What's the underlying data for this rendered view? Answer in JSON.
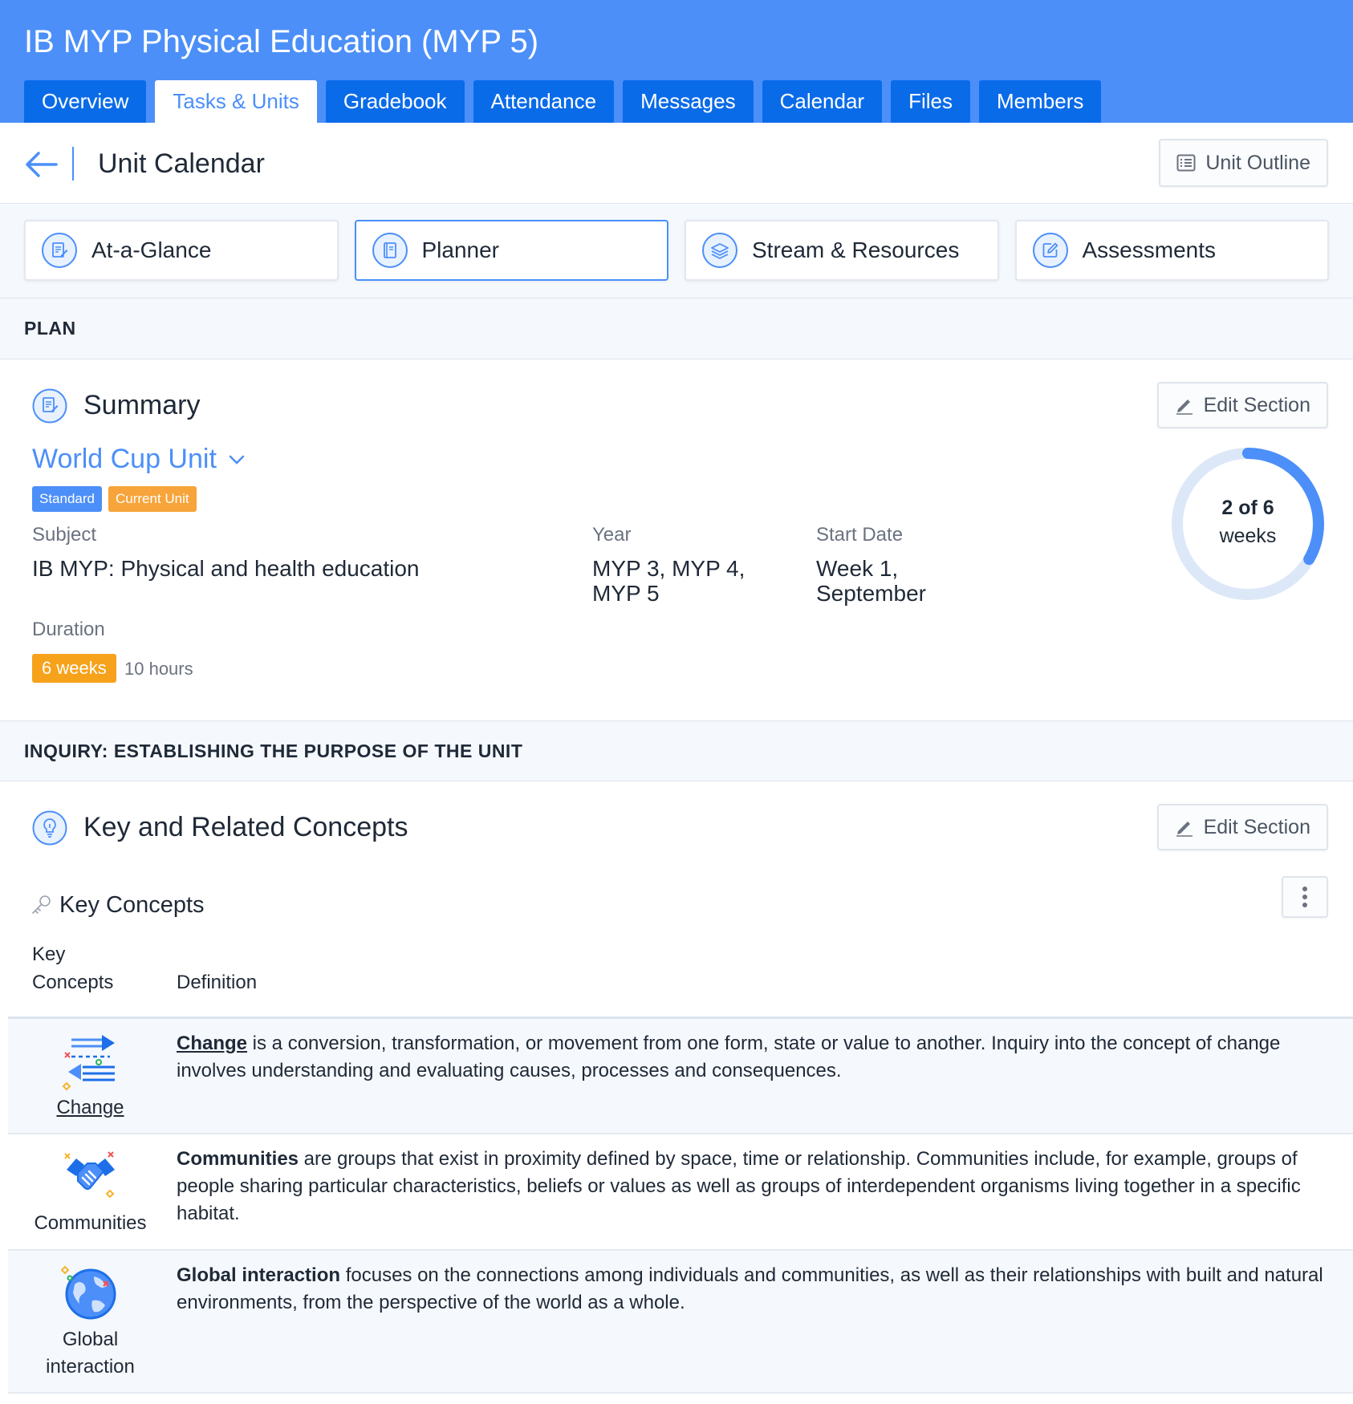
{
  "header": {
    "course_title": "IB MYP Physical Education (MYP 5)",
    "tabs": [
      {
        "label": "Overview"
      },
      {
        "label": "Tasks & Units",
        "active": true
      },
      {
        "label": "Gradebook"
      },
      {
        "label": "Attendance"
      },
      {
        "label": "Messages"
      },
      {
        "label": "Calendar"
      },
      {
        "label": "Files"
      },
      {
        "label": "Members"
      }
    ]
  },
  "subheader": {
    "title": "Unit Calendar",
    "unit_outline_label": "Unit Outline"
  },
  "subtabs": [
    {
      "label": "At-a-Glance",
      "icon": "document-edit-icon"
    },
    {
      "label": "Planner",
      "icon": "book-icon",
      "active": true
    },
    {
      "label": "Stream & Resources",
      "icon": "layers-icon"
    },
    {
      "label": "Assessments",
      "icon": "edit-square-icon"
    }
  ],
  "plan": {
    "heading": "PLAN",
    "summary": {
      "title": "Summary",
      "edit_label": "Edit Section",
      "unit_name": "World Cup Unit",
      "badges": {
        "standard": "Standard",
        "current": "Current Unit"
      },
      "subject_label": "Subject",
      "subject_value": "IB MYP: Physical and health education",
      "year_label": "Year",
      "year_value_line1": "MYP 3, MYP 4,",
      "year_value_line2": "MYP 5",
      "start_label": "Start Date",
      "start_value_line1": "Week 1,",
      "start_value_line2": "September",
      "duration_label": "Duration",
      "duration_weeks": "6 weeks",
      "duration_hours": "10 hours",
      "progress_num": "2 of 6",
      "progress_unit": "weeks",
      "progress_current": 2,
      "progress_total": 6
    }
  },
  "inquiry": {
    "heading": "INQUIRY: ESTABLISHING THE PURPOSE OF THE UNIT",
    "concepts": {
      "title": "Key and Related Concepts",
      "edit_label": "Edit Section",
      "subtitle": "Key Concepts",
      "col_key_line1": "Key",
      "col_key_line2": "Concepts",
      "col_definition": "Definition",
      "rows": [
        {
          "name": "Change",
          "term": "Change",
          "definition": " is a conversion, transformation, or movement from one form, state or value to another. Inquiry into the concept of change involves understanding and evaluating causes, processes and consequences."
        },
        {
          "name": "Communities",
          "term": "Communities",
          "definition": " are groups that exist in proximity defined by space, time or relationship. Communities include, for example, groups of people sharing particular characteristics, beliefs or values as well as groups of interdependent organisms living together in a specific habitat."
        },
        {
          "name_line1": "Global",
          "name_line2": "interaction",
          "term": "Global interaction",
          "definition": " focuses on the connections among individuals and communities, as well as their relationships with built and natural environments, from the perspective of the world as a whole."
        }
      ]
    }
  },
  "colors": {
    "primary": "#4c8ff9",
    "tab_dark": "#0a6be8",
    "orange": "#f7a21b",
    "progress_track": "#dce8f8"
  }
}
